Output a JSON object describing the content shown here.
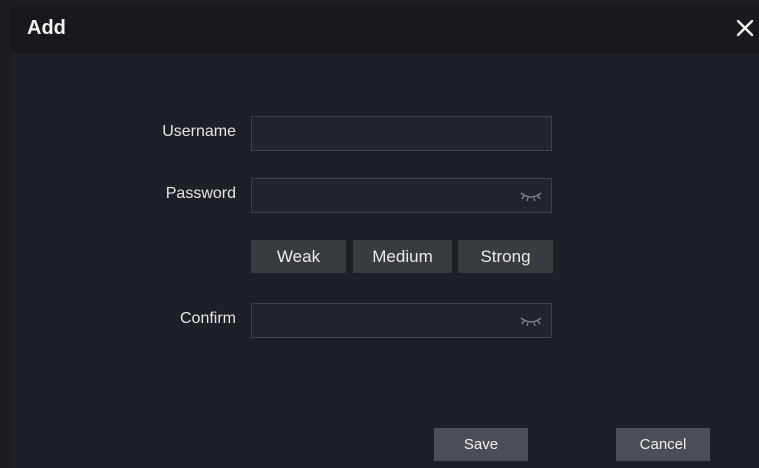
{
  "dialog": {
    "title": "Add",
    "close_icon": "close-icon"
  },
  "form": {
    "username": {
      "label": "Username",
      "value": "",
      "placeholder": ""
    },
    "password": {
      "label": "Password",
      "value": "",
      "placeholder": "",
      "toggle_icon": "eye-closed-icon"
    },
    "strength": {
      "levels": [
        "Weak",
        "Medium",
        "Strong"
      ]
    },
    "confirm": {
      "label": "Confirm",
      "value": "",
      "placeholder": "",
      "toggle_icon": "eye-closed-icon"
    }
  },
  "actions": {
    "save_label": "Save",
    "cancel_label": "Cancel"
  },
  "colors": {
    "dialog_bg": "#1d2026",
    "titlebar_bg": "#17191d",
    "input_border": "#3c414b",
    "button_bg": "#4b4e55",
    "strength_bg": "#383b40"
  }
}
